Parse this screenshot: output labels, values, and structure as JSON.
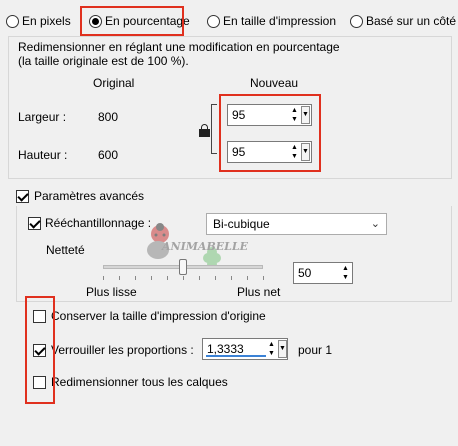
{
  "mode_options": [
    {
      "label": "En pixels",
      "selected": false
    },
    {
      "label": "En pourcentage",
      "selected": true
    },
    {
      "label": "En taille d'impression",
      "selected": false
    },
    {
      "label": "Basé sur un côté",
      "selected": false
    }
  ],
  "resize_group": {
    "description_line1": "Redimensionner en réglant une modification en pourcentage",
    "description_line2": "(la taille originale est de 100 %).",
    "col_original": "Original",
    "col_new": "Nouveau",
    "width_label": "Largeur :",
    "width_original": "800",
    "width_new": "95",
    "height_label": "Hauteur :",
    "height_original": "600",
    "height_new": "95",
    "lock_icon": "lock-icon"
  },
  "advanced": {
    "label": "Paramètres avancés",
    "checked": true,
    "resample_label": "Rééchantillonnage :",
    "resample_checked": true,
    "resample_method": "Bi-cubique",
    "sharpness_label": "Netteté",
    "sharpness_value": "50",
    "sharpness_fraction": 0.5,
    "sharpness_min_label": "Plus lisse",
    "sharpness_max_label": "Plus net"
  },
  "options": {
    "keep_print_size_label": "Conserver la taille d'impression d'origine",
    "keep_print_size_checked": false,
    "lock_ratio_label": "Verrouiller les proportions :",
    "lock_ratio_checked": true,
    "ratio_value": "1,3333",
    "ratio_suffix": "pour 1",
    "resize_layers_label": "Redimensionner tous les calques",
    "resize_layers_checked": false
  },
  "watermark": {
    "text": "ANIMABELLE"
  },
  "colors": {
    "highlight": "#e0301e",
    "accent_underline": "#3b82d6"
  }
}
